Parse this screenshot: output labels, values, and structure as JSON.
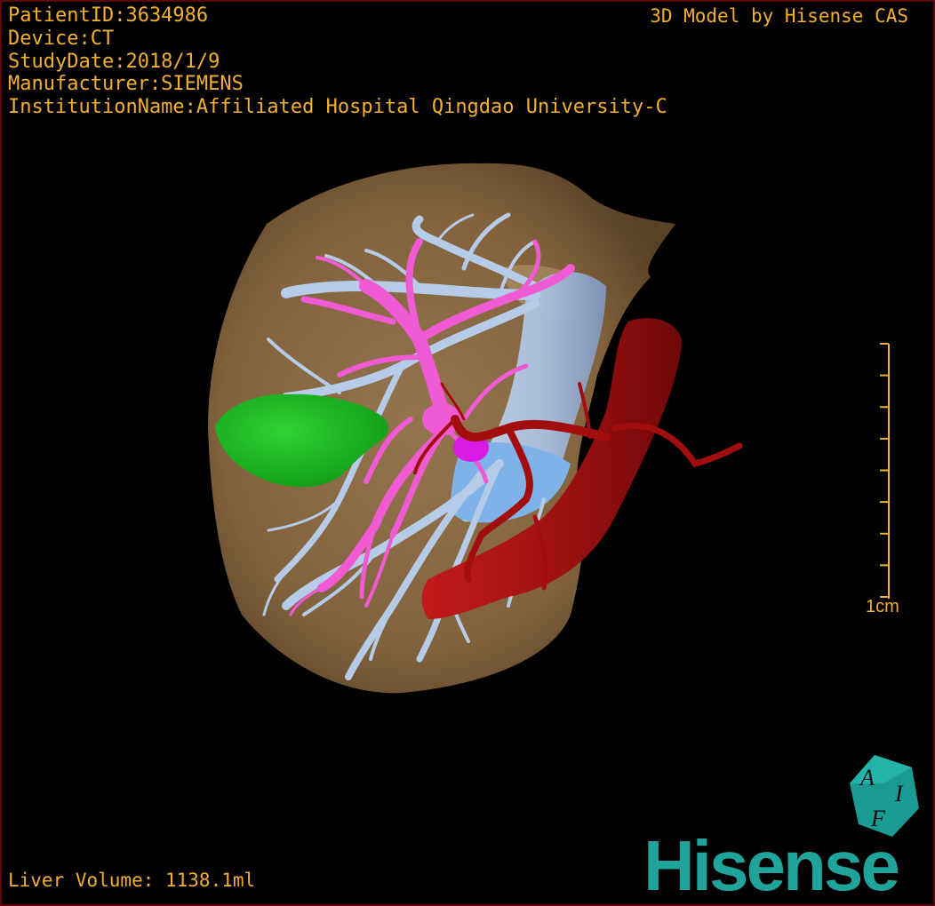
{
  "patient_info": {
    "patient_id": "PatientID:3634986",
    "device": "Device:CT",
    "study_date": "StudyDate:2018/1/9",
    "manufacturer": "Manufacturer:SIEMENS",
    "institution": "InstitutionName:Affiliated Hospital Qingdao University-C"
  },
  "model_credit": "3D Model by Hisense CAS",
  "liver_volume": "Liver Volume: 1138.1ml",
  "scale": {
    "label": "1cm",
    "ticks": 9
  },
  "brand": {
    "name": "Hisense",
    "logo_letters": [
      "A",
      "I",
      "F"
    ]
  },
  "colors": {
    "overlay_text": "#f2b02e",
    "liver": "#8a6a44",
    "portal_vein": "#f05ad2",
    "hepatic_vein": "#b8cde8",
    "artery": "#a20e0e",
    "lesion": "#16b81c",
    "brand": "#1fa39b"
  }
}
